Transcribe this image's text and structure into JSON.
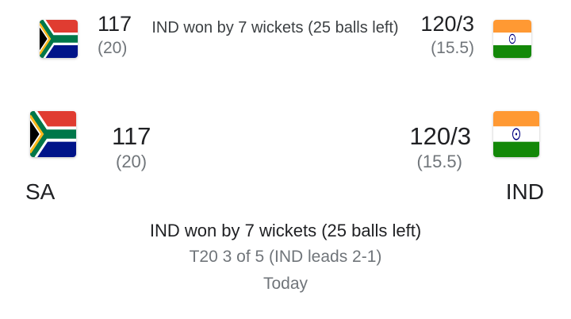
{
  "compact": {
    "team1": {
      "score": "117",
      "overs": "(20)",
      "flag_icon": "south-africa-flag-icon"
    },
    "team2": {
      "score": "120/3",
      "overs": "(15.5)",
      "flag_icon": "india-flag-icon"
    },
    "result": "IND won by 7 wickets (25 balls left)"
  },
  "detail": {
    "team1": {
      "name": "SA",
      "score": "117",
      "overs": "(20)",
      "flag_icon": "south-africa-flag-icon"
    },
    "team2": {
      "name": "IND",
      "score": "120/3",
      "overs": "(15.5)",
      "flag_icon": "india-flag-icon"
    }
  },
  "match_info": {
    "result": "IND won by 7 wickets (25 balls left)",
    "series": "T20 3 of 5 (IND leads 2-1)",
    "date": "Today"
  },
  "colors": {
    "india_saffron": "#FF9933",
    "india_green": "#138808",
    "india_chakra": "#000080",
    "sa_red": "#E03C31",
    "sa_blue": "#001489",
    "sa_green": "#007749",
    "sa_gold": "#FFB81C"
  }
}
